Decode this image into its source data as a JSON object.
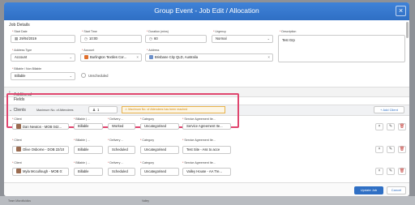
{
  "window": {
    "title": "Group Event - Job Edit  / Allocation"
  },
  "job_details": {
    "section_title": "Job Details",
    "start_date": {
      "label": "Start Date",
      "value": "29/04/2019"
    },
    "start_time": {
      "label": "Start Time",
      "value": "10:00"
    },
    "duration": {
      "label": "Duration (mins)",
      "value": "60"
    },
    "urgency": {
      "label": "Urgency",
      "value": "Normal"
    },
    "description": {
      "label": "Description",
      "value": "Test Grp"
    },
    "address_type": {
      "label": "Address Type",
      "value": "Account"
    },
    "account": {
      "label": "Account",
      "value": "Burlington Textiles Cor..."
    },
    "address": {
      "label": "Address",
      "value": "Brisbane City QLD, Australia"
    },
    "billable": {
      "label": "Billable / Non Billable",
      "value": "Billable"
    },
    "unscheduled": {
      "label": "Unscheduled"
    }
  },
  "additional_fields": {
    "label": "Additional Fields"
  },
  "clients": {
    "label": "Clients",
    "max_attendees_label": "Maximum No. of Attendees",
    "max_attendees_value": "1",
    "warning": "Maximum No. of Attendees has been reached",
    "add_client_label": "+ Add Client",
    "headers": [
      "Client",
      "Billable | ...",
      "Delivery ...",
      "Category",
      "Service Agreement Ite..."
    ],
    "rows": [
      {
        "client": "Dan Newton - MOB 042...",
        "billable": "Billable",
        "delivery": "Worked",
        "category": "Uncategorised",
        "service": "Service Agreement Ite..."
      },
      {
        "client": "Olive Osborne - DOB 22/10",
        "billable": "Billable",
        "delivery": "Scheduled",
        "category": "Uncategorised",
        "service": "Test Site - Ass to acce"
      },
      {
        "client": "Myla Mccullough - MOB 0:",
        "billable": "Billable",
        "delivery": "Scheduled",
        "category": "Uncategorised",
        "service": "Valley House - AA Tre..."
      }
    ]
  },
  "footer": {
    "update_label": "Update Job",
    "cancel_label": "Cancel"
  },
  "background": {
    "left_text": "Team Microfluidics",
    "mid_text": "Valley"
  },
  "colors": {
    "header_blue": "#2f6fc4",
    "highlight": "#e0466f",
    "warning": "#d08a12"
  }
}
